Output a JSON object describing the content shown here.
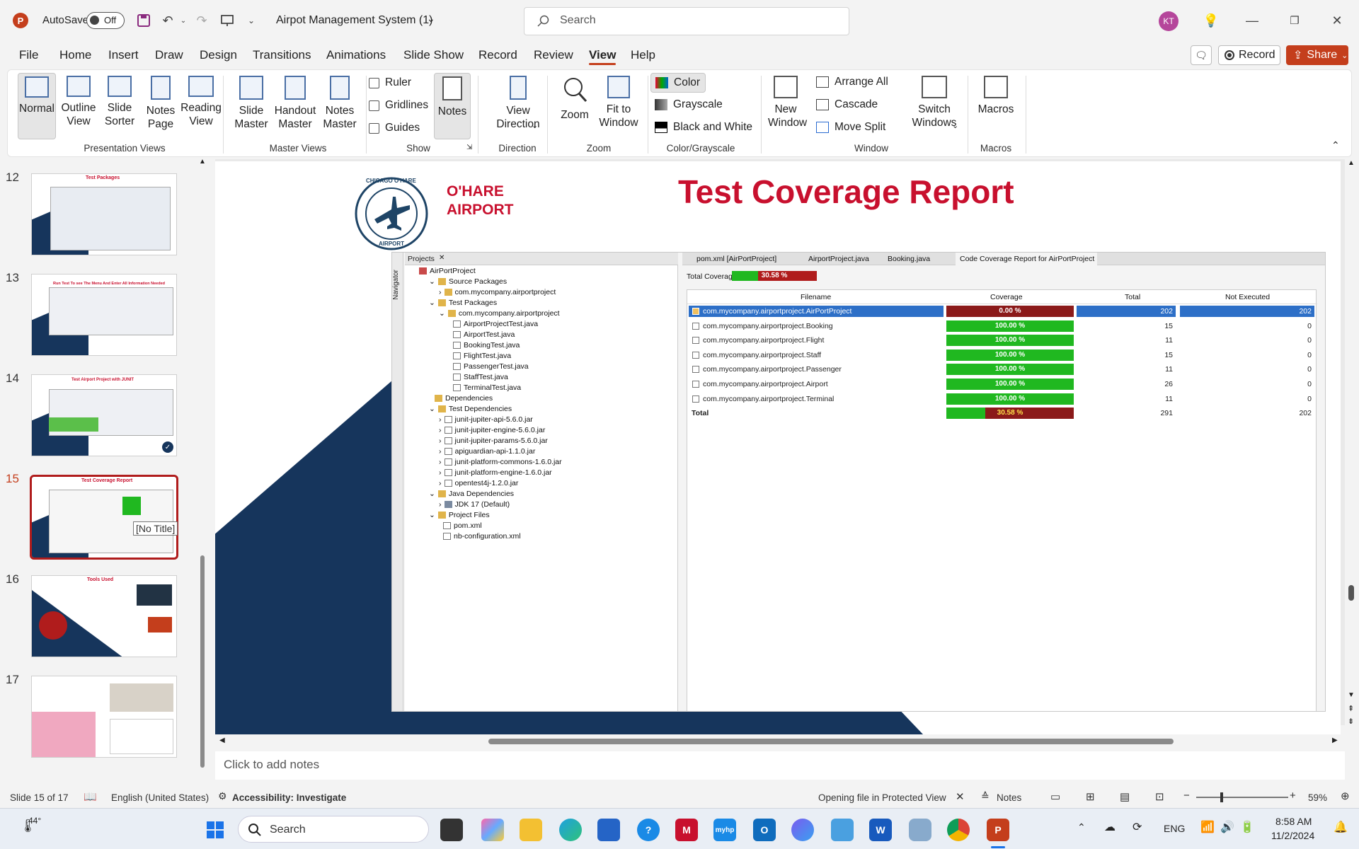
{
  "titlebar": {
    "autosave_label": "AutoSave",
    "autosave_state": "Off",
    "doc_title": "Airpot Management System (1)",
    "search_placeholder": "Search",
    "user_initials": "KT"
  },
  "menu": [
    "File",
    "Home",
    "Insert",
    "Draw",
    "Design",
    "Transitions",
    "Animations",
    "Slide Show",
    "Record",
    "Review",
    "View",
    "Help"
  ],
  "menu_active": "View",
  "menu_right": {
    "record": "Record",
    "share": "Share"
  },
  "ribbon": {
    "presentation_views": {
      "label": "Presentation Views",
      "normal": "Normal",
      "outline": "Outline View",
      "sorter": "Slide Sorter",
      "notes_page": "Notes Page",
      "reading": "Reading View"
    },
    "master_views": {
      "label": "Master Views",
      "slide_master": "Slide Master",
      "handout_master": "Handout Master",
      "notes_master": "Notes Master"
    },
    "show": {
      "label": "Show",
      "ruler": "Ruler",
      "gridlines": "Gridlines",
      "guides": "Guides",
      "notes": "Notes"
    },
    "direction": {
      "label": "Direction",
      "view_direction": "View Direction"
    },
    "zoom": {
      "label": "Zoom",
      "zoom": "Zoom",
      "fit": "Fit to Window"
    },
    "color": {
      "label": "Color/Grayscale",
      "color": "Color",
      "grayscale": "Grayscale",
      "bw": "Black and White"
    },
    "window": {
      "label": "Window",
      "new_window": "New Window",
      "arrange_all": "Arrange All",
      "cascade": "Cascade",
      "move_split": "Move Split",
      "switch_windows": "Switch Windows"
    },
    "macros": {
      "label": "Macros",
      "macros": "Macros"
    }
  },
  "thumbnails": [
    {
      "num": "12",
      "title": "Test Packages"
    },
    {
      "num": "13",
      "title": "Run Test To see The Menu And Enter All Information Needed"
    },
    {
      "num": "14",
      "title": "Test Airport Project with JUNIT"
    },
    {
      "num": "15",
      "title": "Test Coverage Report",
      "tooltip": "[No Title]"
    },
    {
      "num": "16",
      "title": "Tools Used"
    },
    {
      "num": "17",
      "title": ""
    }
  ],
  "slide": {
    "org_line1": "O'HARE",
    "org_line2": "AIRPORT",
    "seal_top": "CHICAGO O'HARE",
    "seal_bottom": "AIRPORT",
    "title": "Test Coverage Report",
    "ide": {
      "projects_tab": "Projects",
      "navigator": "Navigator",
      "tree": [
        "AirPortProject",
        "Source Packages",
        "com.mycompany.airportproject",
        "Test Packages",
        "com.mycompany.airportproject",
        "AirportProjectTest.java",
        "AirportTest.java",
        "BookingTest.java",
        "FlightTest.java",
        "PassengerTest.java",
        "StaffTest.java",
        "TerminalTest.java",
        "Dependencies",
        "Test Dependencies",
        "junit-jupiter-api-5.6.0.jar",
        "junit-jupiter-engine-5.6.0.jar",
        "junit-jupiter-params-5.6.0.jar",
        "apiguardian-api-1.1.0.jar",
        "junit-platform-commons-1.6.0.jar",
        "junit-platform-engine-1.6.0.jar",
        "opentest4j-1.2.0.jar",
        "Java Dependencies",
        "JDK 17 (Default)",
        "Project Files",
        "pom.xml",
        "nb-configuration.xml"
      ],
      "editor_tabs": [
        "pom.xml [AirPortProject]",
        "AirportProject.java",
        "Booking.java",
        "Code Coverage Report for AirPortProject"
      ],
      "total_coverage_label": "Total Coverage:",
      "total_coverage_value": "30.58 %",
      "columns": [
        "Filename",
        "Coverage",
        "Total",
        "Not Executed"
      ],
      "rows": [
        {
          "file": "com.mycompany.airportproject.AirPortProject",
          "coverage": "0.00 %",
          "pct": 0,
          "total": "202",
          "not_exec": "202"
        },
        {
          "file": "com.mycompany.airportproject.Booking",
          "coverage": "100.00 %",
          "pct": 100,
          "total": "15",
          "not_exec": "0"
        },
        {
          "file": "com.mycompany.airportproject.Flight",
          "coverage": "100.00 %",
          "pct": 100,
          "total": "11",
          "not_exec": "0"
        },
        {
          "file": "com.mycompany.airportproject.Staff",
          "coverage": "100.00 %",
          "pct": 100,
          "total": "15",
          "not_exec": "0"
        },
        {
          "file": "com.mycompany.airportproject.Passenger",
          "coverage": "100.00 %",
          "pct": 100,
          "total": "11",
          "not_exec": "0"
        },
        {
          "file": "com.mycompany.airportproject.Airport",
          "coverage": "100.00 %",
          "pct": 100,
          "total": "26",
          "not_exec": "0"
        },
        {
          "file": "com.mycompany.airportproject.Terminal",
          "coverage": "100.00 %",
          "pct": 100,
          "total": "11",
          "not_exec": "0"
        }
      ],
      "total_row": {
        "file": "Total",
        "coverage": "30.58 %",
        "pct": 30.58,
        "total": "291",
        "not_exec": "202"
      }
    }
  },
  "notes_placeholder": "Click to add notes",
  "status": {
    "slide_of": "Slide 15 of 17",
    "language": "English (United States)",
    "accessibility": "Accessibility: Investigate",
    "protected": "Opening file in Protected View",
    "notes": "Notes",
    "zoom": "59%"
  },
  "taskbar": {
    "weather": "44°",
    "search": "Search",
    "lang": "ENG",
    "time": "8:58 AM",
    "date": "11/2/2024"
  },
  "colors": {
    "accent_red": "#c43e1c",
    "title_red": "#c8102e",
    "navy": "#16355c",
    "cov_green": "#20b820",
    "cov_red": "#8b1a1a"
  }
}
